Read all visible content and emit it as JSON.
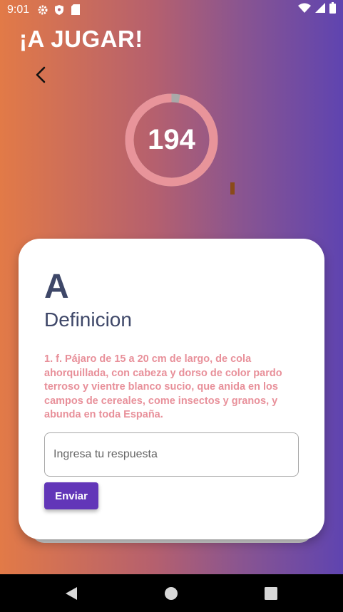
{
  "status_bar": {
    "time": "9:01",
    "icons_left": [
      "gear-icon",
      "shield-icon",
      "sd-card-icon"
    ],
    "icons_right": [
      "wifi-icon",
      "signal-icon",
      "battery-icon"
    ]
  },
  "header": {
    "title": "¡A JUGAR!",
    "back_icon": "chevron-left-icon"
  },
  "timer": {
    "value": "194",
    "progress_fraction": 0.97,
    "ring_color": "#e8949a",
    "elapsed_color": "#a9a9a9"
  },
  "card": {
    "letter": "A",
    "subtitle": "Definicion",
    "definition": "1. f. Pájaro de 15 a 20 cm de largo, de cola ahorquillada, con cabeza y dorso de color pardo terroso y vientre blanco sucio, que anida en los campos de cereales, come insectos y granos, y abunda en toda España.",
    "input_placeholder": "Ingresa tu respuesta",
    "input_value": "",
    "send_label": "Enviar"
  },
  "nav_bar": {
    "icons": [
      "back-triangle-icon",
      "home-circle-icon",
      "recents-square-icon"
    ]
  },
  "colors": {
    "gradient_start": "#e27a47",
    "gradient_end": "#5f44b0",
    "accent": "#6236b8",
    "definition_text": "#e8909a",
    "heading_text": "#3e4768"
  }
}
